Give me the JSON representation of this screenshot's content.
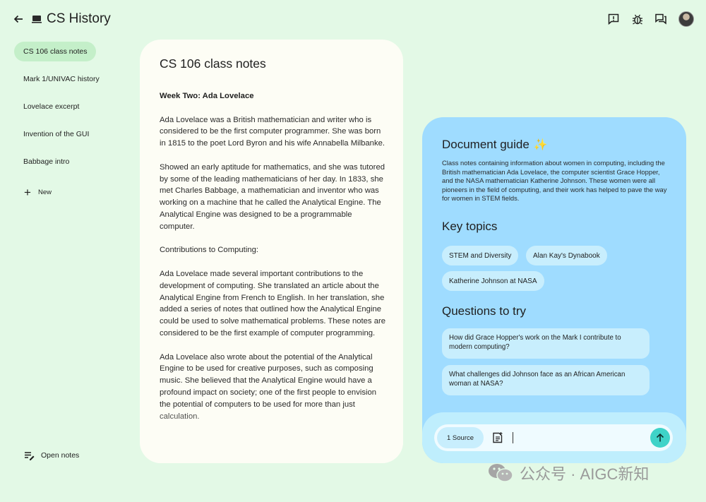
{
  "header": {
    "title": "CS History",
    "icons": [
      "back-arrow-icon",
      "laptop-icon",
      "feedback-icon",
      "bug-icon",
      "chat-icon",
      "avatar"
    ]
  },
  "sidebar": {
    "items": [
      {
        "label": "CS 106 class notes",
        "active": true
      },
      {
        "label": "Mark 1/UNIVAC history",
        "active": false
      },
      {
        "label": "Lovelace excerpt",
        "active": false
      },
      {
        "label": "Invention of the GUI",
        "active": false
      },
      {
        "label": "Babbage intro",
        "active": false
      }
    ],
    "new_label": "New",
    "open_notes_label": "Open notes"
  },
  "notes": {
    "title": "CS 106 class notes",
    "heading": "Week Two: Ada Lovelace",
    "paragraphs": [
      "Ada Lovelace was a British mathematician and writer who is considered to be the first computer programmer. She was born in 1815 to the poet Lord Byron and his wife Annabella Milbanke.",
      "Showed an early aptitude for mathematics, and she was tutored by some of the leading mathematicians of her day. In 1833, she met Charles Babbage, a mathematician and inventor who was working on a machine that he called the Analytical Engine. The Analytical Engine was designed to be a programmable computer.",
      "Contributions to Computing:",
      "Ada Lovelace made several important contributions to the development of computing. She translated an article about the Analytical Engine from French to English. In her translation, she added a series of notes that outlined how the Analytical Engine could be used to solve mathematical problems. These notes are considered to be the first example of computer programming.",
      "Ada Lovelace also wrote about the potential of the Analytical Engine to be used for creative purposes, such as composing music. She believed that the Analytical Engine would have a profound impact on society; one of the first people to envision the potential of computers to be used for more than just calculation."
    ]
  },
  "guide": {
    "title": "Document guide",
    "summary": "Class notes containing information about women in computing, including the British mathematician Ada Lovelace, the computer scientist Grace Hopper, and the NASA mathematician Katherine Johnson. These women were all pioneers in the field of computing, and their work has helped to pave the way for women in STEM fields.",
    "key_topics_title": "Key topics",
    "topics": [
      "STEM and Diversity",
      "Alan Kay's Dynabook",
      "Katherine Johnson at NASA"
    ],
    "questions_title": "Questions to try",
    "questions": [
      "How did Grace Hopper's work on the Mark I contribute to modern computing?",
      "What challenges did Johnson face as an African American woman at NASA?"
    ],
    "source_label": "1 Source"
  },
  "watermark": {
    "text": "公众号 · AIGC新知"
  },
  "colors": {
    "background": "#e3f9e6",
    "active_item": "#c4efc9",
    "notes_card": "#fdfdf5",
    "guide_card": "#9fdcff",
    "chip": "#c8eefd",
    "send_button": "#3fd3c8"
  }
}
